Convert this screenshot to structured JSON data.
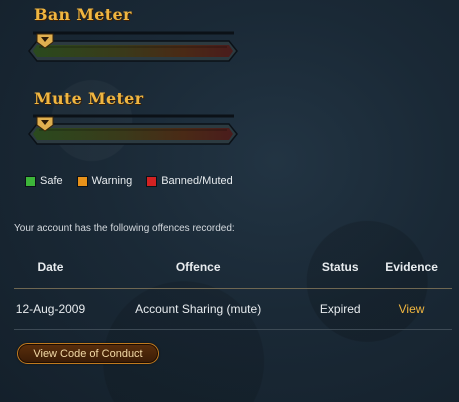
{
  "ban_meter": {
    "title": "Ban Meter",
    "level_percent": 0
  },
  "mute_meter": {
    "title": "Mute Meter",
    "level_percent": 0
  },
  "legend": [
    {
      "label": "Safe",
      "color": "#3db53a"
    },
    {
      "label": "Warning",
      "color": "#e8921a"
    },
    {
      "label": "Banned/Muted",
      "color": "#d32222"
    }
  ],
  "intro_text": "Your account has the following offences recorded:",
  "table": {
    "headers": [
      "Date",
      "Offence",
      "Status",
      "Evidence"
    ],
    "rows": [
      {
        "date": "12-Aug-2009",
        "offence": "Account Sharing (mute)",
        "status": "Expired",
        "evidence": "View"
      }
    ]
  },
  "coc_button": "View Code of Conduct",
  "colors": {
    "accent_gold": "#f0b640",
    "background": "#1a2936"
  }
}
